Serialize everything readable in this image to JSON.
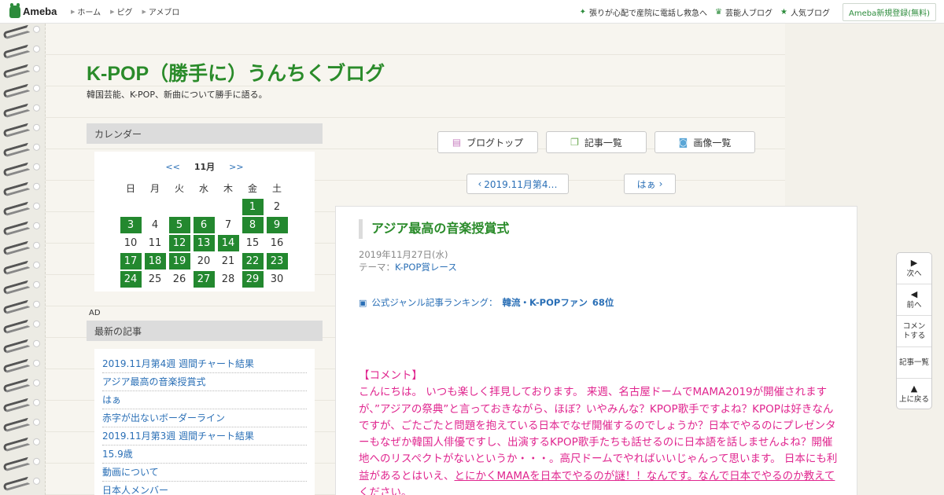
{
  "topbar": {
    "logo": "Ameba",
    "nav": [
      "ホーム",
      "ピグ",
      "アメブロ"
    ],
    "right": [
      {
        "icon": "star-icon",
        "label": "張りが心配で産院に電話し救急へ"
      },
      {
        "icon": "crown-icon",
        "label": "芸能人ブログ"
      },
      {
        "icon": "star-icon",
        "label": "人気ブログ"
      }
    ],
    "signup": "Ameba新規登録(無料)"
  },
  "blog": {
    "title": "K-POP（勝手に）うんちくブログ",
    "description": "韓国芸能、K-POP、新曲について勝手に語る。"
  },
  "sidebar": {
    "calendar_heading": "カレンダー",
    "calendar": {
      "prev": "<<",
      "month": "11月",
      "next": ">>",
      "weekdays": [
        "日",
        "月",
        "火",
        "水",
        "木",
        "金",
        "土"
      ],
      "weeks": [
        [
          "",
          "",
          "",
          "",
          "",
          "1",
          "2"
        ],
        [
          "3",
          "4",
          "5",
          "6",
          "7",
          "8",
          "9"
        ],
        [
          "10",
          "11",
          "12",
          "13",
          "14",
          "15",
          "16"
        ],
        [
          "17",
          "18",
          "19",
          "20",
          "21",
          "22",
          "23"
        ],
        [
          "24",
          "25",
          "26",
          "27",
          "28",
          "29",
          "30"
        ]
      ],
      "post_days": [
        "1",
        "3",
        "5",
        "6",
        "8",
        "9",
        "12",
        "13",
        "14",
        "17",
        "18",
        "19",
        "22",
        "23",
        "24",
        "27",
        "29"
      ]
    },
    "ad_label": "AD",
    "recent_heading": "最新の記事",
    "recent_posts": [
      "2019.11月第4週 週間チャート結果",
      "アジア最高の音楽授賞式",
      "はぁ",
      "赤字が出ないボーダーライン",
      "2019.11月第3週 週間チャート結果",
      "15.9歳",
      "動画について",
      "日本人メンバー"
    ]
  },
  "buttons": {
    "blog_top": "ブログトップ",
    "entry_list": "記事一覧",
    "image_list": "画像一覧",
    "prev_post": "2019.11月第4…",
    "next_post": "はぁ"
  },
  "article": {
    "title": "アジア最高の音楽授賞式",
    "date": "2019年11月27日(水)",
    "theme_label": "テーマ：",
    "theme": "K-POP賞レース",
    "ranking_label": "公式ジャンル記事ランキング：",
    "ranking_genre": "韓流・K-POPファン",
    "ranking_position": "68位",
    "comment_heading": "【コメント】",
    "comment_text": "こんにちは。 いつも楽しく拝見しております。 来週、名古屋ドームでMAMA2019が開催されますが、”アジアの祭典”と言っておきながら、ほぼ？いやみんな？KPOP歌手ですよね？KPOPは好きなんですが、ごたごたと問題を抱えている日本でなぜ開催するのでしょうか？日本でやるのにプレゼンターもなぜか韓国人俳優ですし、出演するKPOP歌手たちも話せるのに日本語を話しませんよね？開催地へのリスペクトがないというか・・・。高尺ドームでやればいいじゃんって思います。 日本にも利益があるとはいえ、",
    "comment_underlined": "とにかくMAMAを日本でやるのが謎！！なんです。なんで日本でやるのか教えてください。"
  },
  "floating_nav": {
    "next": "次へ",
    "prev": "前へ",
    "comment": "コメントする",
    "list": "記事一覧",
    "top": "上に戻る"
  }
}
